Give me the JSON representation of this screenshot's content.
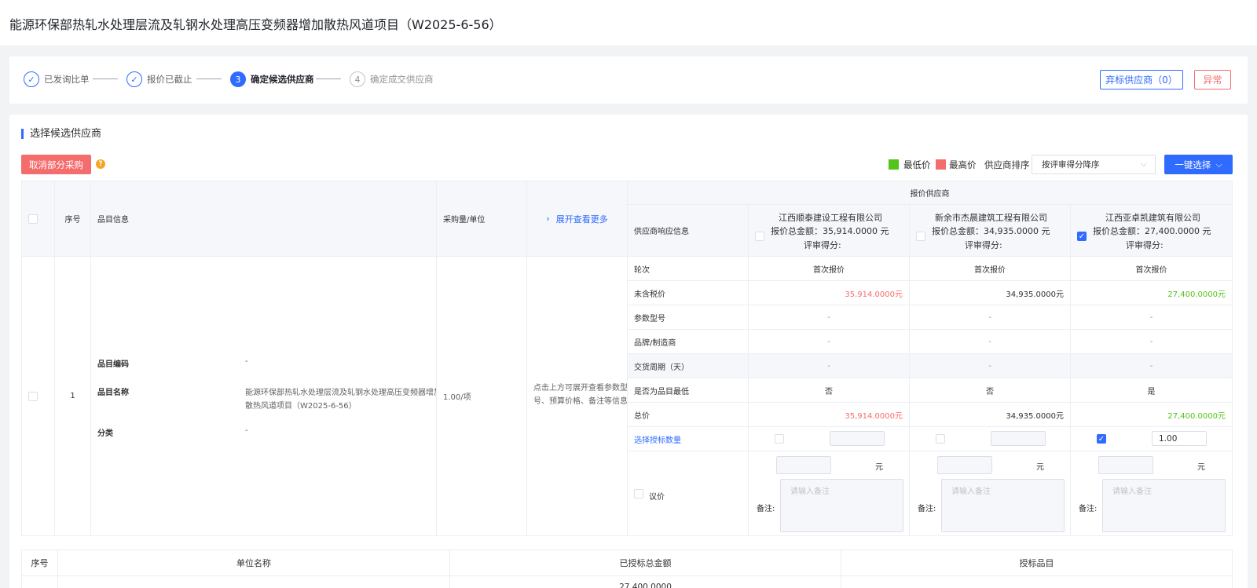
{
  "page": {
    "title": "能源环保部热轧水处理层流及轧钢水处理高压变频器增加散热风道项目（W2025-6-56）"
  },
  "steps": [
    {
      "index": "✓",
      "label": "已发询比单",
      "state": "done"
    },
    {
      "index": "✓",
      "label": "报价已截止",
      "state": "done"
    },
    {
      "index": "3",
      "label": "确定候选供应商",
      "state": "active"
    },
    {
      "index": "4",
      "label": "确定成交供应商",
      "state": "todo"
    }
  ],
  "top_actions": {
    "abandon_label": "弃标供应商（0）",
    "abnormal_label": "异常"
  },
  "section": {
    "title": "选择候选供应商",
    "cancel_label": "取消部分采购",
    "help_icon": "?",
    "legend_low": "最低价",
    "legend_high": "最高价",
    "sort_label": "供应商排序",
    "sort_value": "按评审得分降序",
    "one_click_label": "一键选择",
    "colors": {
      "low": "#52c41a",
      "high": "#f56c6c",
      "accent": "#2f6bff"
    }
  },
  "table": {
    "headers": {
      "seq": "序号",
      "item_info": "品目信息",
      "qty_unit": "采购量/单位",
      "expand": "展开查看更多",
      "quote_supplier": "报价供应商",
      "supplier_response": "供应商响应信息"
    },
    "suppliers": [
      {
        "name": "江西顺泰建设工程有限公司",
        "total": "报价总金额：35,914.0000 元",
        "score": "评审得分:",
        "checked": false
      },
      {
        "name": "新余市杰晨建筑工程有限公司",
        "total": "报价总金额：34,935.0000 元",
        "score": "评审得分:",
        "checked": false
      },
      {
        "name": "江西亚卓凯建筑有限公司",
        "total": "报价总金额：27,400.0000 元",
        "score": "评审得分:",
        "checked": true
      }
    ],
    "row": {
      "seq": "1",
      "item_code_label": "品目编码",
      "item_code_value": "-",
      "item_name_label": "品目名称",
      "item_name_value_line1": "能源环保部热轧水处理层流及轧钢水处理高压变频器增加",
      "item_name_value_line2": "散热风道项目（W2025-6-56）",
      "category_label": "分类",
      "category_value": "-",
      "qty_unit": "1.00/项",
      "expand_hint_line1": "点击上方可展开查看参数型",
      "expand_hint_line2": "号、预算价格、备注等信息"
    },
    "attributes": [
      {
        "label": "轮次",
        "values": [
          "首次报价",
          "首次报价",
          "首次报价"
        ]
      },
      {
        "label": "未含税价",
        "values": [
          "35,914.0000元",
          "34,935.0000元",
          "27,400.0000元"
        ]
      },
      {
        "label": "参数型号",
        "values": [
          "-",
          "-",
          "-"
        ]
      },
      {
        "label": "品牌/制造商",
        "values": [
          "-",
          "-",
          "-"
        ]
      },
      {
        "label": "交货周期（天）",
        "values": [
          "-",
          "-",
          "-"
        ]
      },
      {
        "label": "是否为品目最低",
        "values": [
          "否",
          "否",
          "是"
        ]
      },
      {
        "label": "总价",
        "values": [
          "35,914.0000元",
          "34,935.0000元",
          "27,400.0000元"
        ]
      }
    ],
    "select_qty_label": "选择授标数量",
    "select_qty_values": [
      "",
      "",
      "1.00"
    ],
    "negotiate_label": "议价",
    "unit_yuan": "元",
    "remark_label": "备注:",
    "remark_placeholder": "请输入备注"
  },
  "summary_table": {
    "headers": {
      "seq": "序号",
      "unit_name": "单位名称",
      "awarded_total": "已授标总金额",
      "awarded_item": "授标品目"
    },
    "partial_value": "27,400.0000"
  }
}
